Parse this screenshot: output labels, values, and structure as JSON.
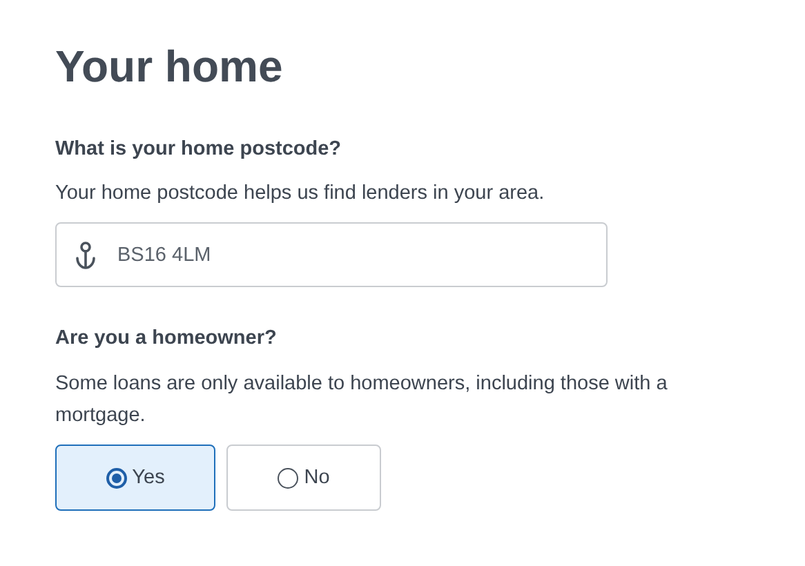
{
  "title": "Your home",
  "postcode": {
    "label": "What is your home postcode?",
    "help": "Your home postcode helps us find lenders in your area.",
    "value": "BS16 4LM"
  },
  "homeowner": {
    "label": "Are you a homeowner?",
    "help": "Some loans are only available to homeowners, including those with a mortgage.",
    "options": [
      {
        "label": "Yes",
        "selected": true
      },
      {
        "label": "No",
        "selected": false
      }
    ]
  }
}
